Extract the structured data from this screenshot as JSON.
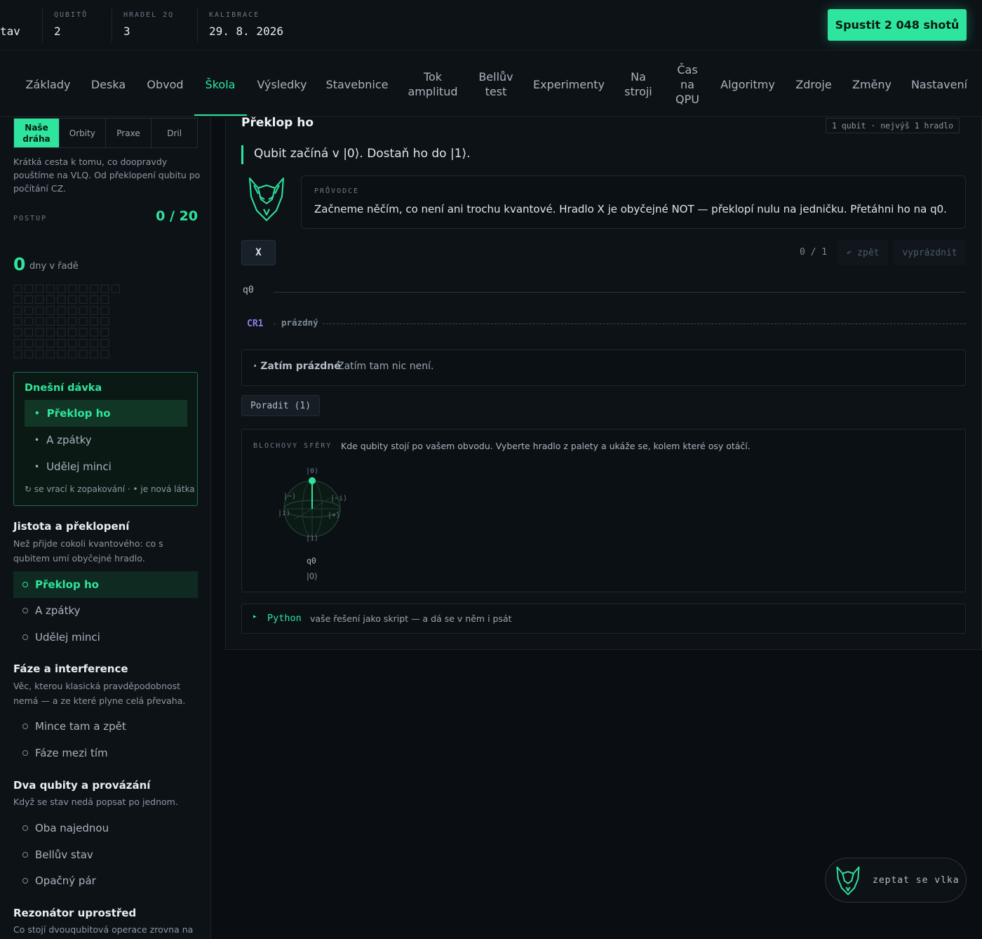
{
  "status": {
    "cut_label": "tav",
    "qubits": {
      "label": "QUBITŮ",
      "value": "2"
    },
    "gates": {
      "label": "HRADEL 2Q",
      "value": "3"
    },
    "calibration": {
      "label": "KALIBRACE",
      "value": "29. 8. 2026"
    },
    "run_button": "Spustit 2 048 shotů"
  },
  "nav": {
    "items": [
      "Základy",
      "Deska",
      "Obvod",
      "Škola",
      "Výsledky",
      "Stavebnice",
      "Tok amplitud",
      "Bellův test",
      "Experimenty",
      "Na stroji",
      "Čas na QPU",
      "Algoritmy",
      "Zdroje",
      "Změny",
      "Nastavení"
    ],
    "active": "Škola"
  },
  "sidebar": {
    "tabs": [
      "Naše dráha",
      "Orbity",
      "Praxe",
      "Dril"
    ],
    "intro": "Krátká cesta k tomu, co doopravdy pouštíme na VLQ. Od překlopení qubitu po počítání CZ.",
    "progress_label": "POSTUP",
    "progress_value": "0 / 20",
    "streak_value": "0",
    "streak_label": "dny v řadě",
    "today": {
      "title": "Dnešní dávka",
      "items": [
        "Překlop ho",
        "A zpátky",
        "Udělej minci"
      ],
      "legend": "↻ se vrací k zopakování · • je nová látka"
    },
    "sections": [
      {
        "title": "Jistota a překlopení",
        "desc": "Než přijde cokoli kvantového: co s qubitem umí obyčejné hradlo.",
        "lessons": [
          "Překlop ho",
          "A zpátky",
          "Udělej minci"
        ]
      },
      {
        "title": "Fáze a interference",
        "desc": "Věc, kterou klasická pravděpodobnost nemá — a ze které plyne celá převaha.",
        "lessons": [
          "Mince tam a zpět",
          "Fáze mezi tím"
        ]
      },
      {
        "title": "Dva qubity a provázání",
        "desc": "Když se stav nedá popsat po jednom.",
        "lessons": [
          "Oba najednou",
          "Bellův stav",
          "Opačný pár"
        ]
      },
      {
        "title": "Rezonátor uprostřed",
        "desc": "Co stojí dvouqubitová operace zrovna na"
      }
    ]
  },
  "lesson": {
    "title": "Překlop ho",
    "constraint": "1 qubit · nejvýš 1 hradlo",
    "goal": "Qubit začíná v |0⟩. Dostaň ho do |1⟩.",
    "guide_label": "PRŮVODCE",
    "guide_text": "Začneme něčím, co není ani trochu kvantové. Hradlo X je obyčejné NOT — překlopí nulu na jedničku. Přetáhni ho na q0.",
    "palette_gate": "X",
    "counter": "0 / 1",
    "undo": "↶ zpět",
    "clear": "vyprázdnit",
    "wire_label": "q0",
    "classical_label": "CR1",
    "classical_state": "prázdný",
    "status_title": "· Zatím prázdné",
    "status_text": "Zatím tam nic není.",
    "hint_button": "Poradit (1)",
    "bloch": {
      "label": "BLOCHOVY SFÉRY",
      "desc": "Kde qubity stojí po vašem obvodu. Vyberte hradlo z palety a ukáže se, kolem které osy otáčí.",
      "top": "|0⟩",
      "bottom": "|1⟩",
      "minus": "|−⟩",
      "plus": "|+⟩",
      "i_minus": "|−i⟩",
      "i_plus": "|i⟩",
      "qubit": "q0",
      "state": "|0⟩"
    },
    "python_label": "Python",
    "python_desc": "vaše řešení jako skript — a dá se v něm i psát"
  },
  "chat_button": "zeptat se vlka",
  "colors": {
    "accent": "#2ee59d",
    "background": "#0a0e12",
    "panel": "#0d1217"
  },
  "icons": {
    "guide": "wolf-icon",
    "chat": "wolf-icon"
  }
}
